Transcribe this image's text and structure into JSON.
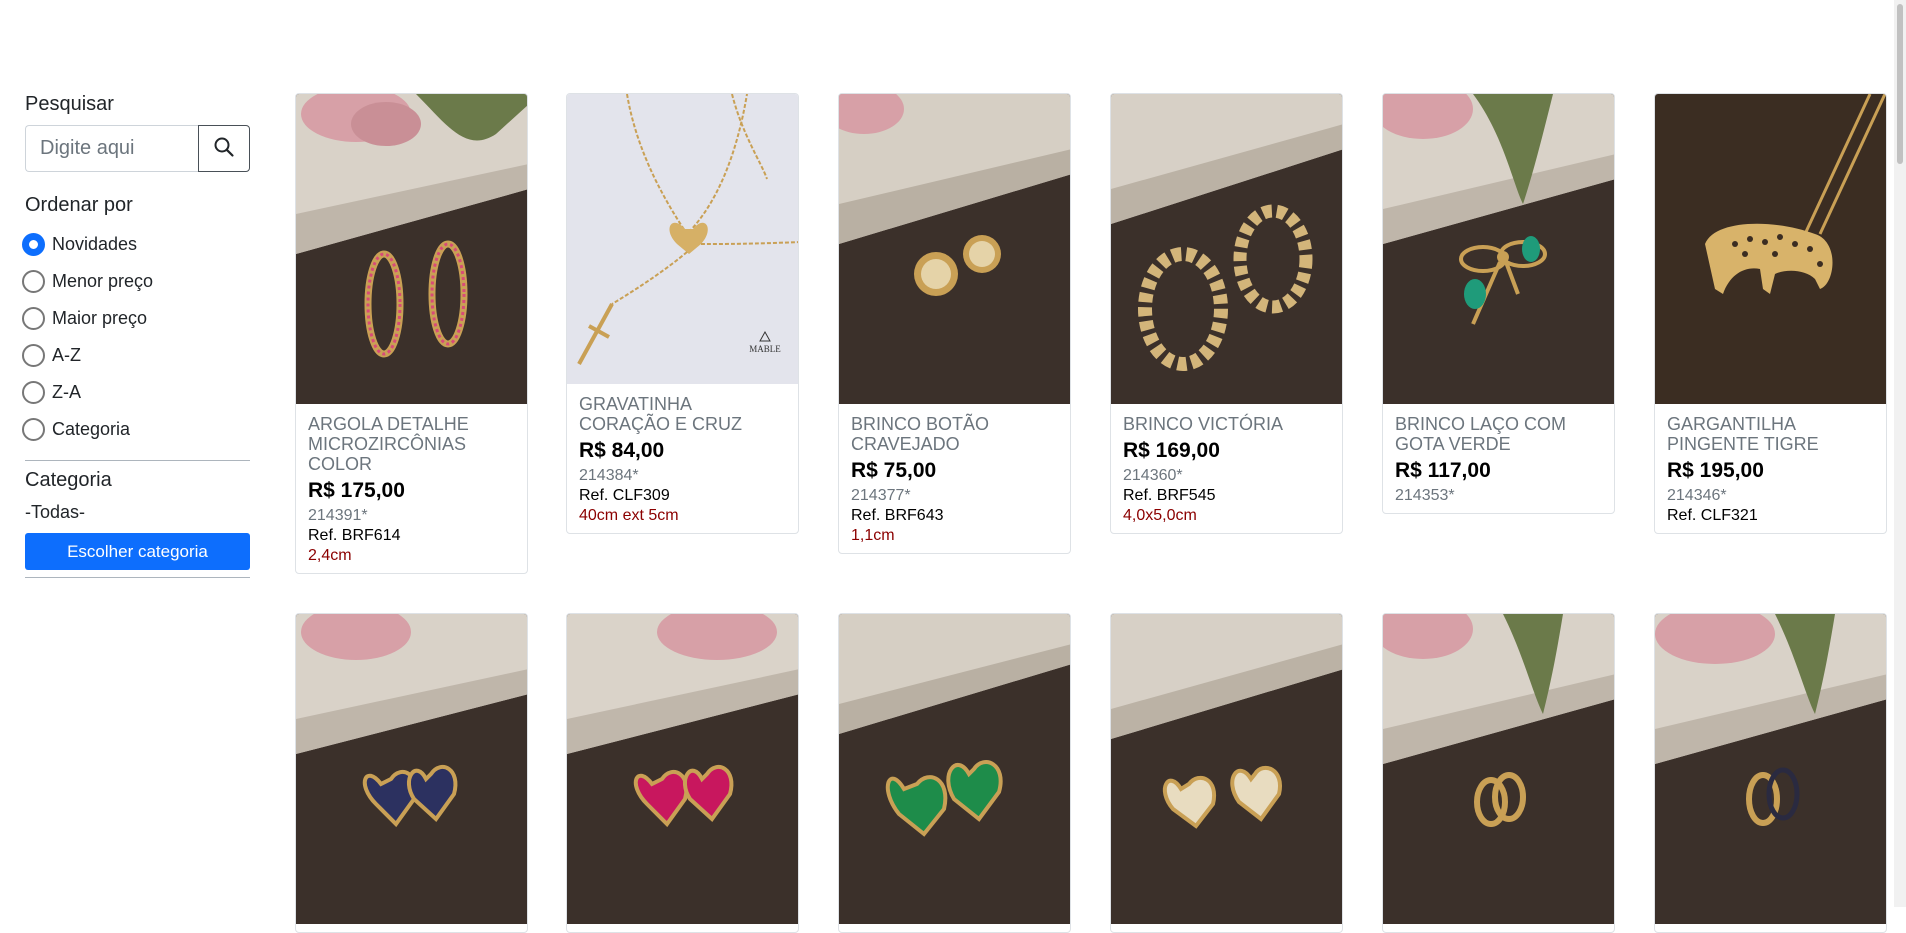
{
  "sidebar": {
    "search": {
      "label": "Pesquisar",
      "placeholder": "Digite aqui"
    },
    "sort": {
      "label": "Ordenar por",
      "options": [
        "Novidades",
        "Menor preço",
        "Maior preço",
        "A-Z",
        "Z-A",
        "Categoria"
      ],
      "selected": "Novidades"
    },
    "category": {
      "label": "Categoria",
      "current": "-Todas-",
      "button": "Escolher categoria"
    }
  },
  "products": [
    {
      "name": "ARGOLA DETALHE MICROZIRCÔNIAS COLOR",
      "price": "R$ 175,00",
      "code": "214391*",
      "ref": "Ref. BRF614",
      "size": "2,4cm"
    },
    {
      "name": "GRAVATINHA CORAÇÃO E CRUZ",
      "price": "R$ 84,00",
      "code": "214384*",
      "ref": "Ref. CLF309",
      "size": "40cm ext 5cm"
    },
    {
      "name": "BRINCO BOTÃO CRAVEJADO",
      "price": "R$ 75,00",
      "code": "214377*",
      "ref": "Ref. BRF643",
      "size": "1,1cm"
    },
    {
      "name": "BRINCO VICTÓRIA",
      "price": "R$ 169,00",
      "code": "214360*",
      "ref": "Ref. BRF545",
      "size": "4,0x5,0cm"
    },
    {
      "name": "BRINCO LAÇO COM GOTA VERDE",
      "price": "R$ 117,00",
      "code": "214353*",
      "ref": "",
      "size": ""
    },
    {
      "name": "GARGANTILHA PINGENTE TIGRE",
      "price": "R$ 195,00",
      "code": "214346*",
      "ref": "Ref. CLF321",
      "size": ""
    }
  ],
  "product_image_watermark": "MABLE"
}
